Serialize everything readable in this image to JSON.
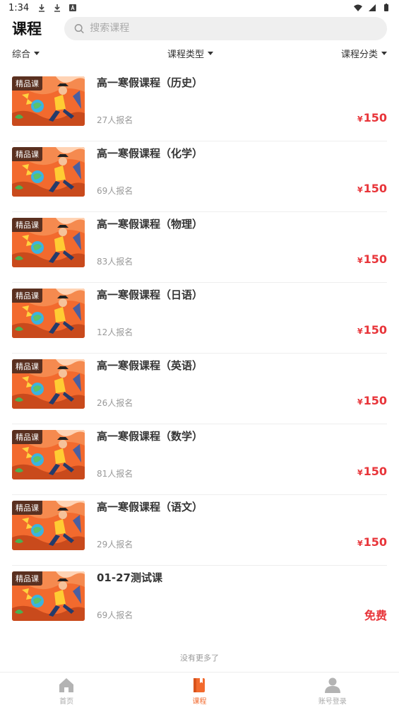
{
  "status_bar": {
    "time": "1:34"
  },
  "header": {
    "title": "课程",
    "search_placeholder": "搜索课程"
  },
  "filters": [
    {
      "label": "综合"
    },
    {
      "label": "课程类型"
    },
    {
      "label": "课程分类"
    }
  ],
  "courses": [
    {
      "tag": "精品课",
      "title": "高一寒假课程（历史）",
      "enroll": "27人报名",
      "currency": "¥",
      "price": "150"
    },
    {
      "tag": "精品课",
      "title": "高一寒假课程（化学）",
      "enroll": "69人报名",
      "currency": "¥",
      "price": "150"
    },
    {
      "tag": "精品课",
      "title": "高一寒假课程（物理）",
      "enroll": "83人报名",
      "currency": "¥",
      "price": "150"
    },
    {
      "tag": "精品课",
      "title": "高一寒假课程（日语）",
      "enroll": "12人报名",
      "currency": "¥",
      "price": "150"
    },
    {
      "tag": "精品课",
      "title": "高一寒假课程（英语）",
      "enroll": "26人报名",
      "currency": "¥",
      "price": "150"
    },
    {
      "tag": "精品课",
      "title": "高一寒假课程（数学）",
      "enroll": "81人报名",
      "currency": "¥",
      "price": "150"
    },
    {
      "tag": "精品课",
      "title": "高一寒假课程（语文）",
      "enroll": "29人报名",
      "currency": "¥",
      "price": "150"
    },
    {
      "tag": "精品课",
      "title": "01-27测试课",
      "enroll": "69人报名",
      "currency": "",
      "price": "免费"
    }
  ],
  "list_footer": "没有更多了",
  "bottom_nav": [
    {
      "label": "首页",
      "icon": "home-icon",
      "active": false
    },
    {
      "label": "课程",
      "icon": "book-icon",
      "active": true
    },
    {
      "label": "账号登录",
      "icon": "user-icon",
      "active": false
    }
  ],
  "colors": {
    "accent": "#f26a2e",
    "price": "#e8353a"
  }
}
